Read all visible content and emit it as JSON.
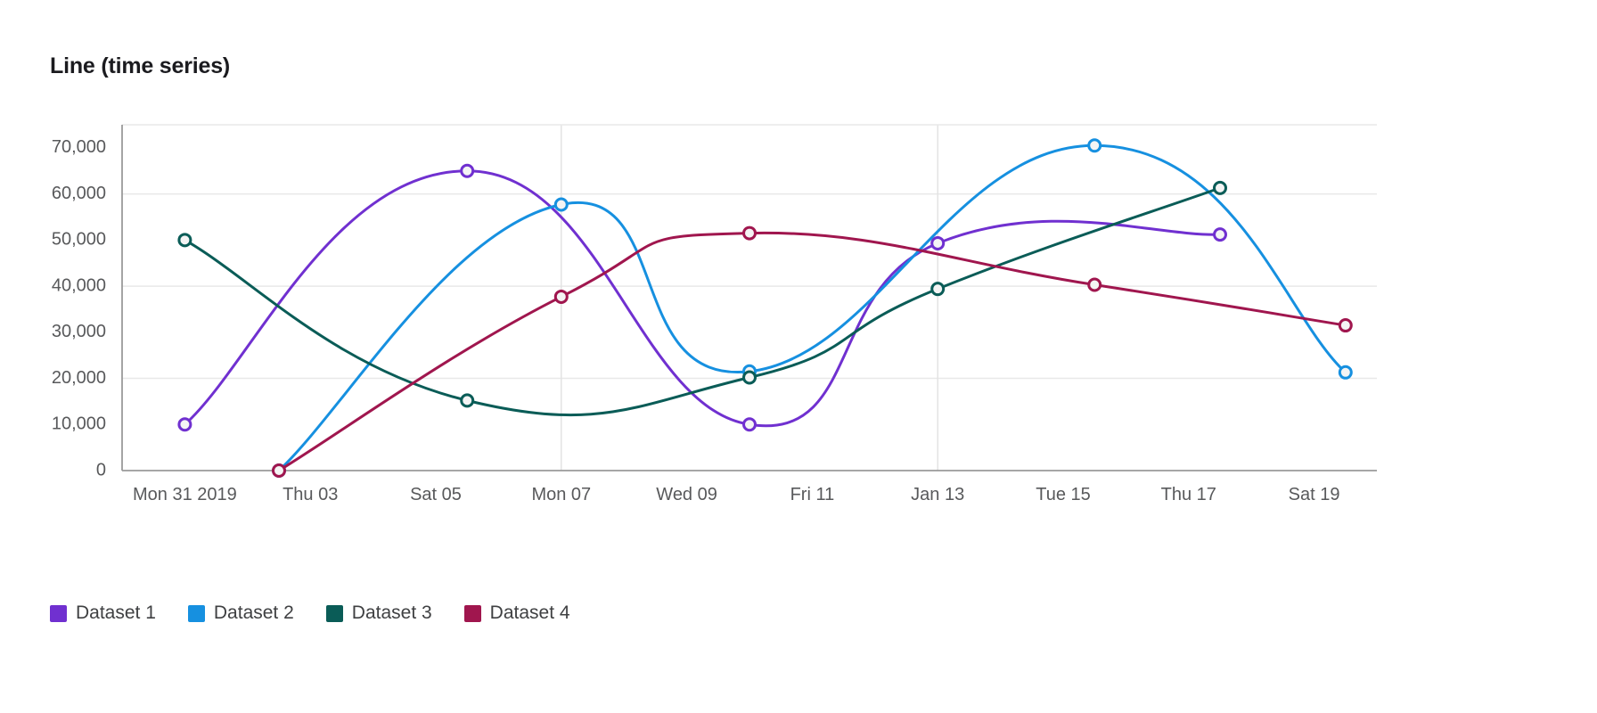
{
  "chart": {
    "title": "Line (time series)"
  },
  "legend": {
    "position": "bottom-left",
    "items": [
      {
        "label": "Dataset 1",
        "color": "#7030d0"
      },
      {
        "label": "Dataset 2",
        "color": "#1690e0"
      },
      {
        "label": "Dataset 3",
        "color": "#0a5c57"
      },
      {
        "label": "Dataset 4",
        "color": "#a0164e"
      }
    ]
  },
  "chart_data": {
    "type": "line",
    "title": "Line (time series)",
    "xlabel": "",
    "ylabel": "",
    "x_tick_labels": [
      "Mon 31 2019",
      "Thu 03",
      "Sat 05",
      "Mon 07",
      "Wed 09",
      "Fri 11",
      "Jan 13",
      "Tue 15",
      "Thu 17",
      "Sat 19"
    ],
    "x_tick_values": [
      0,
      2,
      4,
      6,
      8,
      10,
      12,
      14,
      16,
      18
    ],
    "x": [
      0,
      3,
      6,
      9,
      12,
      15,
      18
    ],
    "xlim": [
      -1,
      19
    ],
    "y_tick_labels": [
      "0",
      "10,000",
      "20,000",
      "30,000",
      "40,000",
      "50,000",
      "60,000",
      "70,000"
    ],
    "y_tick_values": [
      0,
      10000,
      20000,
      30000,
      40000,
      50000,
      60000,
      70000
    ],
    "ylim": [
      0,
      75000
    ],
    "gridlines_y": [
      20000,
      40000,
      60000
    ],
    "grid": true,
    "curve": "smooth",
    "marker": "open-circle",
    "series": [
      {
        "name": "Dataset 1",
        "color": "#7030d0",
        "values": [
          10000,
          65000,
          10000,
          49300,
          51200
        ],
        "x": [
          0,
          4.5,
          9,
          12,
          16.5
        ]
      },
      {
        "name": "Dataset 2",
        "color": "#1690e0",
        "values": [
          0,
          57700,
          21500,
          70500,
          21300
        ],
        "x": [
          1.5,
          6,
          9,
          14.5,
          18.5
        ]
      },
      {
        "name": "Dataset 3",
        "color": "#0a5c57",
        "values": [
          50000,
          15200,
          20200,
          39400,
          61300
        ],
        "x": [
          0,
          4.5,
          9,
          12,
          16.5
        ]
      },
      {
        "name": "Dataset 4",
        "color": "#a0164e",
        "values": [
          0,
          37700,
          51500,
          40300,
          31500
        ],
        "x": [
          1.5,
          6,
          9,
          14.5,
          18.5
        ]
      }
    ]
  }
}
